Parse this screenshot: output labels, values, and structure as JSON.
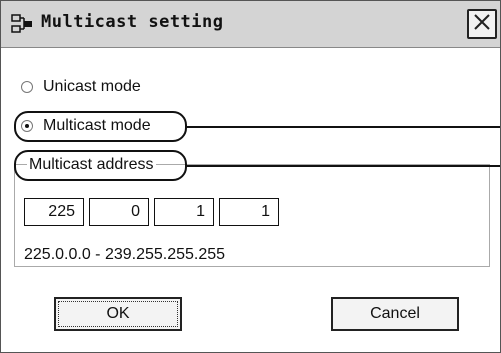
{
  "window": {
    "title": "Multicast setting",
    "icon": "network-settings-icon"
  },
  "modes": {
    "unicast_label": "Unicast mode",
    "multicast_label": "Multicast mode",
    "selected": "multicast"
  },
  "multicast_address": {
    "group_label": "Multicast address",
    "octets": [
      "225",
      "0",
      "1",
      "1"
    ],
    "range_text": "225.0.0.0 - 239.255.255.255"
  },
  "buttons": {
    "ok_label": "OK",
    "cancel_label": "Cancel"
  }
}
